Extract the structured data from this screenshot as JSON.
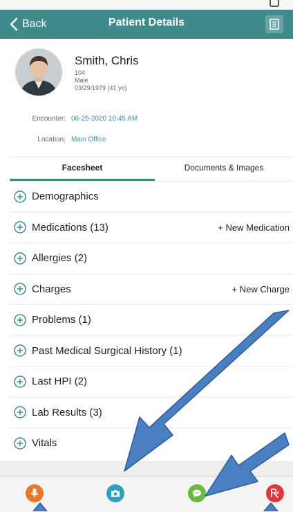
{
  "nav": {
    "back_label": "Back",
    "title": "Patient Details"
  },
  "patient": {
    "name": "Smith, Chris",
    "id": "104",
    "sex": "Male",
    "dob": "03/29/1979 (41 yo)",
    "encounter_label": "Encounter:",
    "encounter_value": "06-25-2020 10:45 AM",
    "location_label": "Location:",
    "location_value": "Main Office"
  },
  "tabs": [
    {
      "label": "Facesheet",
      "active": true
    },
    {
      "label": "Documents & Images",
      "active": false
    }
  ],
  "sections": [
    {
      "label": "Demographics",
      "action": ""
    },
    {
      "label": "Medications (13)",
      "action": "+ New Medication"
    },
    {
      "label": "Allergies (2)",
      "action": ""
    },
    {
      "label": "Charges",
      "action": "+ New Charge"
    },
    {
      "label": "Problems (1)",
      "action": ""
    },
    {
      "label": "Past Medical Surgical History (1)",
      "action": ""
    },
    {
      "label": "Last HPI (2)",
      "action": ""
    },
    {
      "label": "Lab Results (3)",
      "action": ""
    },
    {
      "label": "Vitals",
      "action": ""
    }
  ],
  "toolbar": [
    {
      "icon": "microphone-icon",
      "color": "#e57a2c"
    },
    {
      "icon": "camera-icon",
      "color": "#2f9fc2"
    },
    {
      "icon": "message-icon",
      "color": "#6bb83f"
    },
    {
      "icon": "rx-icon",
      "color": "#e0363e"
    }
  ],
  "colors": {
    "nav": "#3f8a8b",
    "accent_text": "#3d9195",
    "arrow_fill": "#4a7fc1",
    "arrow_stroke": "#2f5a94"
  }
}
